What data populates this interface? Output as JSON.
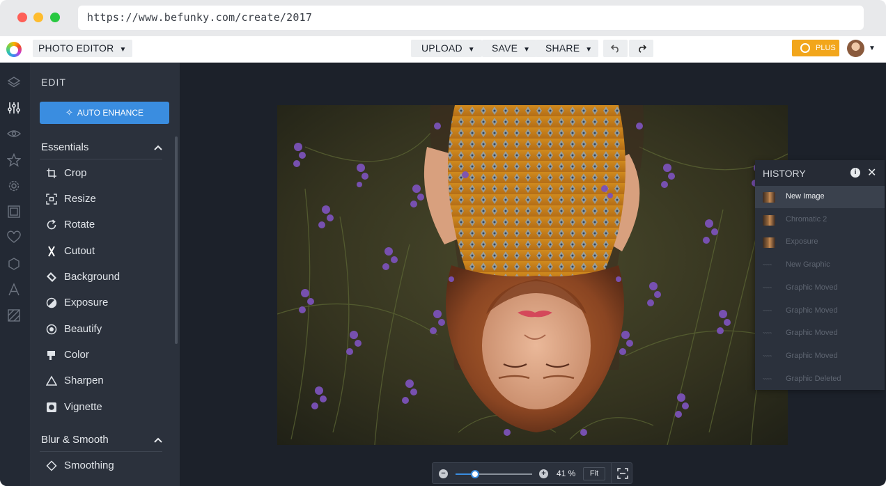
{
  "browser": {
    "url": "https://www.befunky.com/create/2017"
  },
  "topbar": {
    "app_menu": "PHOTO EDITOR",
    "upload": "UPLOAD",
    "save": "SAVE",
    "share": "SHARE",
    "plus": "PLUS"
  },
  "rail": {
    "icons": [
      "layers-icon",
      "sliders-icon",
      "eye-icon",
      "star-icon",
      "badge-icon",
      "frame-icon",
      "heart-icon",
      "shape-icon",
      "text-icon",
      "texture-icon"
    ]
  },
  "panel": {
    "title": "EDIT",
    "auto_enhance": "AUTO ENHANCE",
    "sections": [
      {
        "title": "Essentials",
        "tools": [
          {
            "label": "Crop",
            "icon": "crop-icon"
          },
          {
            "label": "Resize",
            "icon": "resize-icon"
          },
          {
            "label": "Rotate",
            "icon": "rotate-icon"
          },
          {
            "label": "Cutout",
            "icon": "cutout-icon"
          },
          {
            "label": "Background",
            "icon": "background-icon"
          },
          {
            "label": "Exposure",
            "icon": "exposure-icon"
          },
          {
            "label": "Beautify",
            "icon": "beautify-icon"
          },
          {
            "label": "Color",
            "icon": "color-icon"
          },
          {
            "label": "Sharpen",
            "icon": "sharpen-icon"
          },
          {
            "label": "Vignette",
            "icon": "vignette-icon"
          }
        ]
      },
      {
        "title": "Blur & Smooth",
        "tools": [
          {
            "label": "Smoothing",
            "icon": "smoothing-icon"
          }
        ]
      }
    ]
  },
  "history": {
    "title": "HISTORY",
    "items": [
      {
        "label": "New Image",
        "thumb": "photo",
        "active": true
      },
      {
        "label": "Chromatic 2",
        "thumb": "photo",
        "active": false
      },
      {
        "label": "Exposure",
        "thumb": "photo",
        "active": false
      },
      {
        "label": "New Graphic",
        "thumb": "graphic",
        "active": false
      },
      {
        "label": "Graphic Moved",
        "thumb": "graphic",
        "active": false
      },
      {
        "label": "Graphic Moved",
        "thumb": "graphic",
        "active": false
      },
      {
        "label": "Graphic Moved",
        "thumb": "graphic",
        "active": false
      },
      {
        "label": "Graphic Moved",
        "thumb": "graphic",
        "active": false
      },
      {
        "label": "Graphic Deleted",
        "thumb": "graphic",
        "active": false
      }
    ]
  },
  "zoom": {
    "value": "41 %",
    "level": 0.25,
    "fit": "Fit"
  },
  "colors": {
    "accent": "#3a8de0",
    "plus": "#f2a61b",
    "canvas_bg": "#1c212a",
    "panel_bg": "#2b313c"
  }
}
